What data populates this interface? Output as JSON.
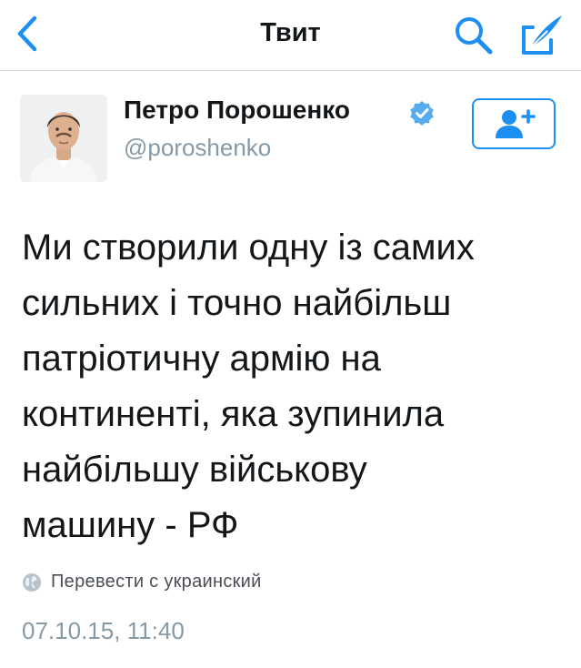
{
  "navbar": {
    "title": "Твит",
    "icons": {
      "back": "chevron-left-icon",
      "search": "search-icon",
      "compose": "compose-icon"
    }
  },
  "author": {
    "name": "Петро Порошенко",
    "handle": "@poroshenko",
    "verified": true,
    "follow_icon": "add-user-icon"
  },
  "tweet": {
    "lines": [
      "Ми створили одну із самих",
      "сильних і точно найбільш",
      "патріотичну армію на",
      "континенті, яка зупинила",
      "найбільшу військову",
      "машину - РФ"
    ]
  },
  "translate": {
    "label": "Перевести с украинский",
    "icon": "globe-icon"
  },
  "timestamp": "07.10.15, 11:40",
  "colors": {
    "accent": "#1d8ef2",
    "verified": "#55acee",
    "muted": "#8899a6"
  }
}
